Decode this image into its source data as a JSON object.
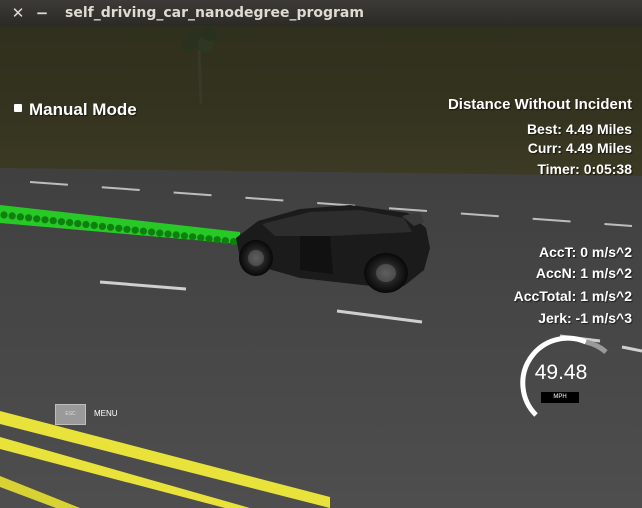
{
  "window": {
    "title": "self_driving_car_nanodegree_program",
    "close_glyph": "✕",
    "minimize_glyph": "−"
  },
  "hud": {
    "mode": "Manual Mode",
    "distance_header": "Distance Without Incident",
    "best": "Best: 4.49 Miles",
    "curr": "Curr: 4.49 Miles",
    "timer": "Timer: 0:05:38",
    "acc_t": "AccT: 0 m/s^2",
    "acc_n": "AccN: 1 m/s^2",
    "acc_total": "AccTotal: 1 m/s^2",
    "jerk": "Jerk: -1 m/s^3"
  },
  "speedometer": {
    "value": "49.48",
    "unit": "MPH"
  },
  "menu": {
    "esc_label": "ESC",
    "label": "MENU"
  },
  "colors": {
    "path_green": "#22e022",
    "lane_yellow": "#e8e23a",
    "road_gray": "#4a4a4a"
  }
}
